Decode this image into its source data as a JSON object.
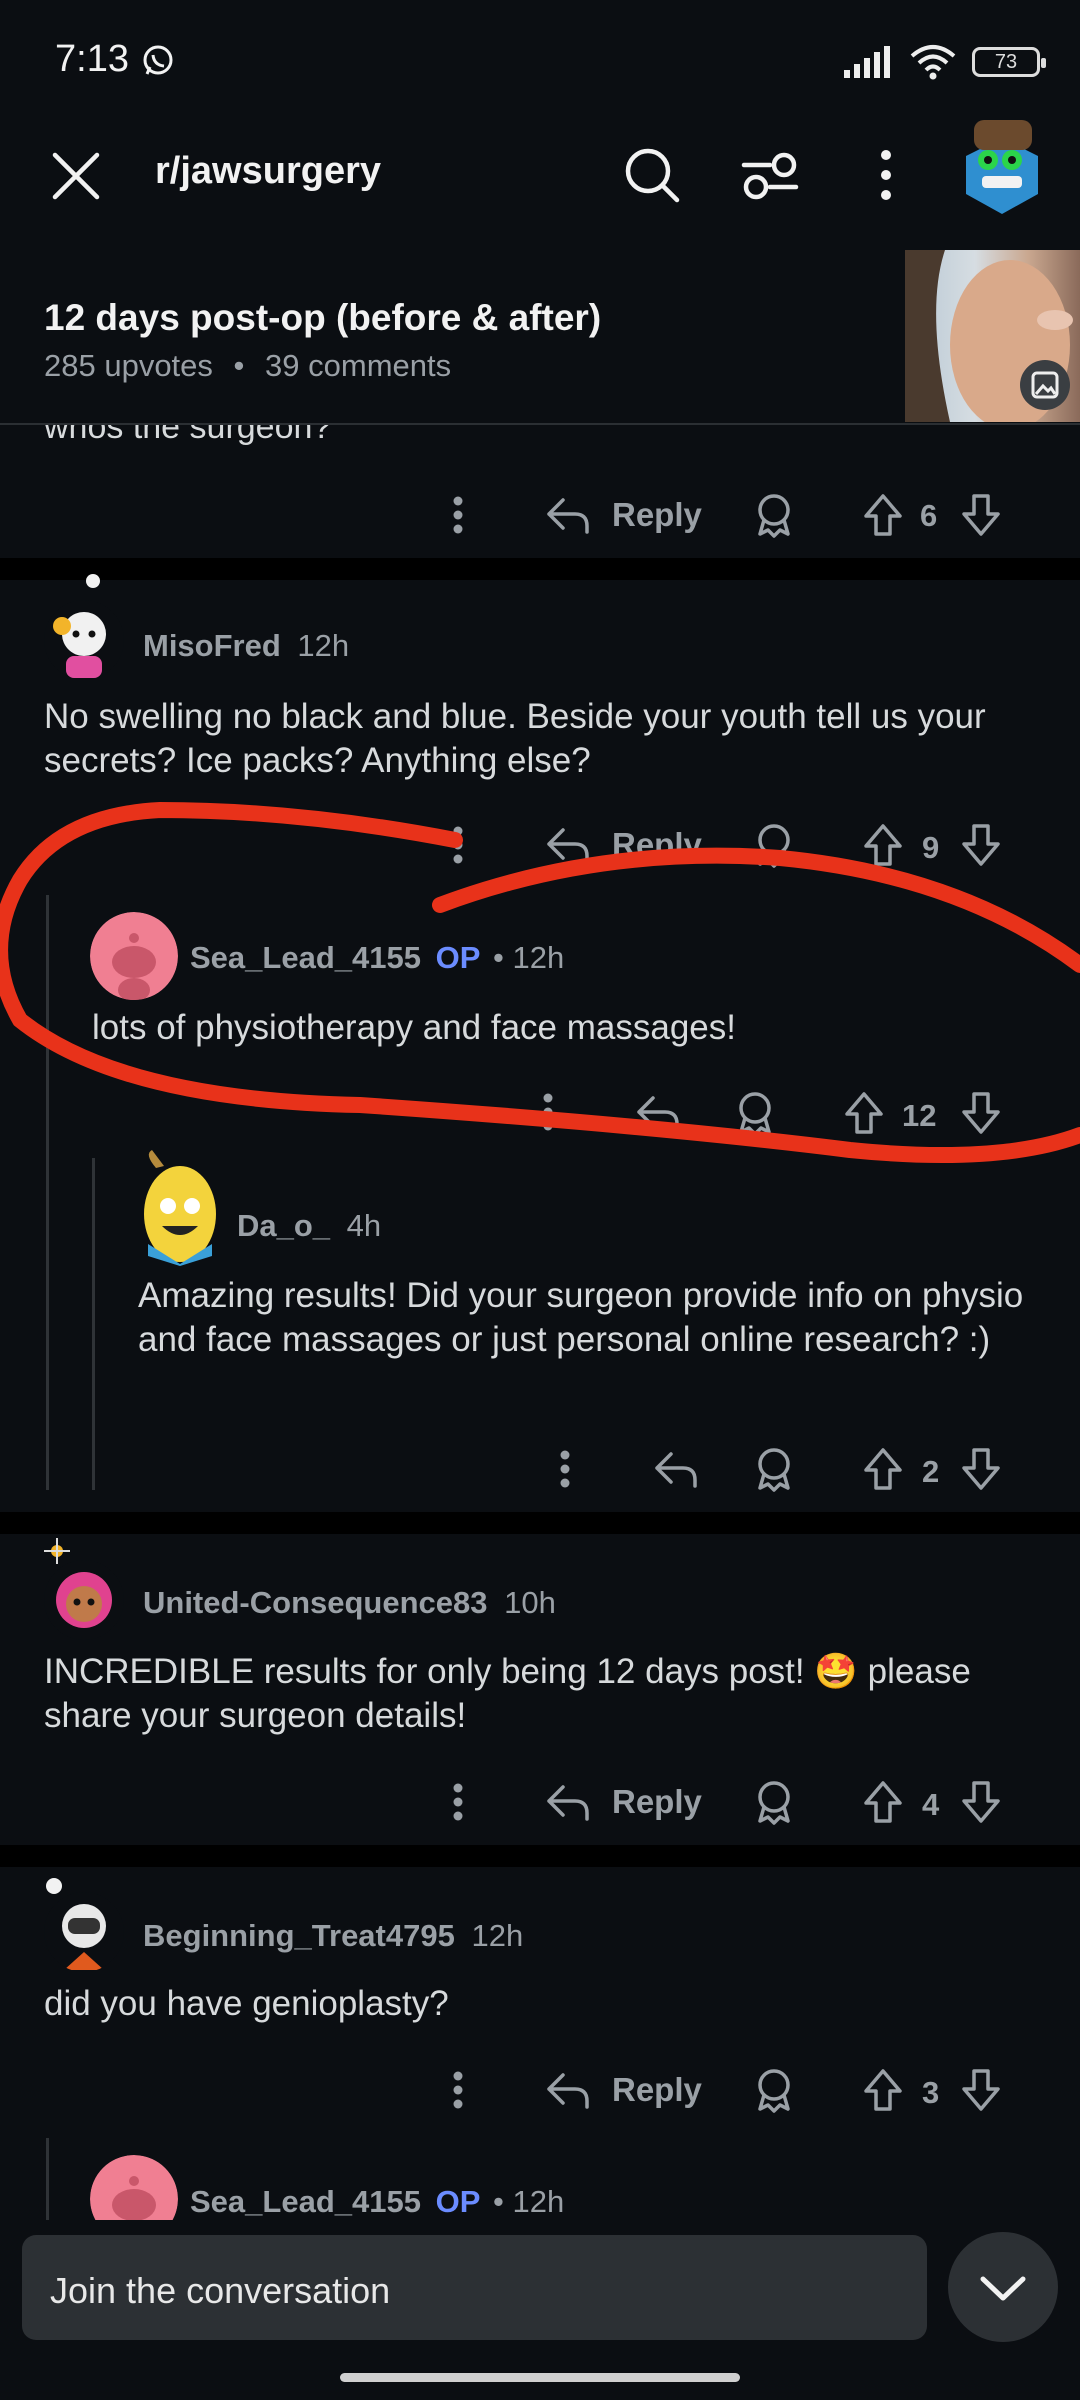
{
  "status": {
    "time": "7:13",
    "battery": "73"
  },
  "toolbar": {
    "title": "r/jawsurgery"
  },
  "post": {
    "title": "12 days post-op (before & after)",
    "upvotes": "285 upvotes",
    "dot": "•",
    "comments": "39 comments"
  },
  "partial_comment": {
    "text": "whos the surgeon?",
    "reply_label": "Reply",
    "votes": "6"
  },
  "comments": [
    {
      "username": "MisoFred",
      "time": "12h",
      "text": "No swelling no black and blue. Beside your youth tell us your secrets? Ice packs? Anything else?",
      "reply_label": "Reply",
      "votes": "9"
    },
    {
      "username": "Sea_Lead_4155",
      "op": "OP",
      "sep": "•",
      "time": "12h",
      "text": "lots of physiotherapy and face massages!",
      "votes": "12"
    },
    {
      "username": "Da_o_",
      "time": "4h",
      "text": "Amazing results! Did your surgeon provide info on physio and face massages or just personal online research? :)",
      "votes": "2"
    },
    {
      "username": "United-Consequence83",
      "time": "10h",
      "text": "INCREDIBLE results for only being 12 days post! 🤩 please share your surgeon details!",
      "reply_label": "Reply",
      "votes": "4"
    },
    {
      "username": "Beginning_Treat4795",
      "time": "12h",
      "text": "did you have genioplasty?",
      "reply_label": "Reply",
      "votes": "3"
    },
    {
      "username": "Sea_Lead_4155",
      "op": "OP",
      "sep": "•",
      "time": "12h"
    }
  ],
  "composer": {
    "placeholder": "Join the conversation"
  },
  "colors": {
    "annotation": "#e8321a",
    "op": "#6b8cff",
    "background": "#0b0e12"
  }
}
